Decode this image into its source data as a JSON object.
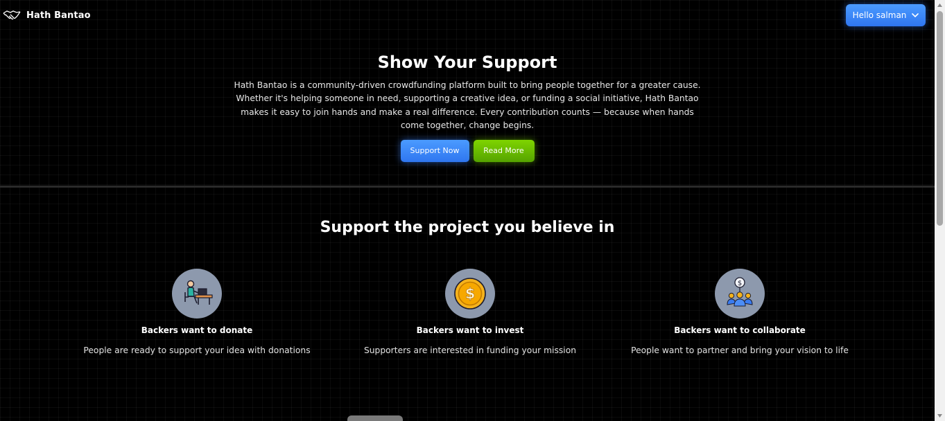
{
  "navbar": {
    "brand_name": "Hath Bantao",
    "brand_icon": "handshake-icon",
    "user_button_label": "Hello salman",
    "user_button_icon": "chevron-down-icon"
  },
  "hero": {
    "title": "Show Your Support",
    "description": "Hath Bantao is a community-driven crowdfunding platform built to bring people together for a greater cause. Whether it's helping someone in need, supporting a creative idea, or funding a social initiative, Hath Bantao makes it easy to join hands and make a real difference. Every contribution counts — because when hands come together, change begins.",
    "support_button_label": "Support Now",
    "read_more_button_label": "Read More"
  },
  "features": {
    "title": "Support the project you believe in",
    "items": [
      {
        "icon": "person-at-desk-icon",
        "title": "Backers want to donate",
        "description": "People are ready to support your idea with donations"
      },
      {
        "icon": "gold-coin-icon",
        "title": "Backers want to invest",
        "description": "Supporters are interested in funding your mission"
      },
      {
        "icon": "group-collaboration-icon",
        "title": "Backers want to collaborate",
        "description": "People want to partner and bring your vision to life"
      }
    ]
  },
  "colors": {
    "background": "#000000",
    "primary_blue": "#3b86f7",
    "accent_green": "#6cc000",
    "icon_circle": "#8d99ad"
  }
}
